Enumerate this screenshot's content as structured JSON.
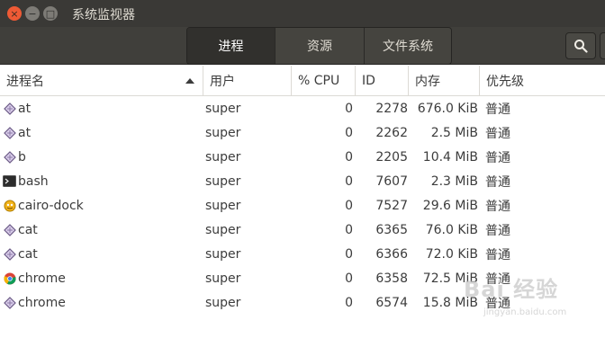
{
  "window": {
    "title": "系统监视器",
    "close_glyph": "×",
    "min_glyph": "−",
    "max_glyph": "□"
  },
  "tabs": [
    {
      "label": "进程",
      "active": true
    },
    {
      "label": "资源",
      "active": false
    },
    {
      "label": "文件系统",
      "active": false
    }
  ],
  "columns": {
    "name": "进程名",
    "user": "用户",
    "cpu": "% CPU",
    "id": "ID",
    "memory": "内存",
    "priority": "优先级"
  },
  "sort": {
    "column": "name",
    "direction": "ascending"
  },
  "processes": [
    {
      "icon": "diamond-icon",
      "name": "at",
      "user": "super",
      "cpu": "0",
      "id": "2278",
      "memory": "676.0 KiB",
      "priority": "普通"
    },
    {
      "icon": "diamond-icon",
      "name": "at",
      "user": "super",
      "cpu": "0",
      "id": "2262",
      "memory": "2.5 MiB",
      "priority": "普通"
    },
    {
      "icon": "diamond-icon",
      "name": "b",
      "user": "super",
      "cpu": "0",
      "id": "2205",
      "memory": "10.4 MiB",
      "priority": "普通"
    },
    {
      "icon": "terminal-icon",
      "name": "bash",
      "user": "super",
      "cpu": "0",
      "id": "7607",
      "memory": "2.3 MiB",
      "priority": "普通"
    },
    {
      "icon": "cairo-dock-icon",
      "name": "cairo-dock",
      "user": "super",
      "cpu": "0",
      "id": "7527",
      "memory": "29.6 MiB",
      "priority": "普通"
    },
    {
      "icon": "diamond-icon",
      "name": "cat",
      "user": "super",
      "cpu": "0",
      "id": "6365",
      "memory": "76.0 KiB",
      "priority": "普通"
    },
    {
      "icon": "diamond-icon",
      "name": "cat",
      "user": "super",
      "cpu": "0",
      "id": "6366",
      "memory": "72.0 KiB",
      "priority": "普通"
    },
    {
      "icon": "chrome-icon",
      "name": "chrome",
      "user": "super",
      "cpu": "0",
      "id": "6358",
      "memory": "72.5 MiB",
      "priority": "普通"
    },
    {
      "icon": "diamond-icon",
      "name": "chrome",
      "user": "super",
      "cpu": "0",
      "id": "6574",
      "memory": "15.8 MiB",
      "priority": "普通"
    }
  ],
  "watermark": {
    "logo": "Bai 经验",
    "url": "jingyan.baidu.com"
  },
  "colors": {
    "titlebar": "#3a3936",
    "headerbar": "#403f3b",
    "close": "#ee5a35"
  }
}
